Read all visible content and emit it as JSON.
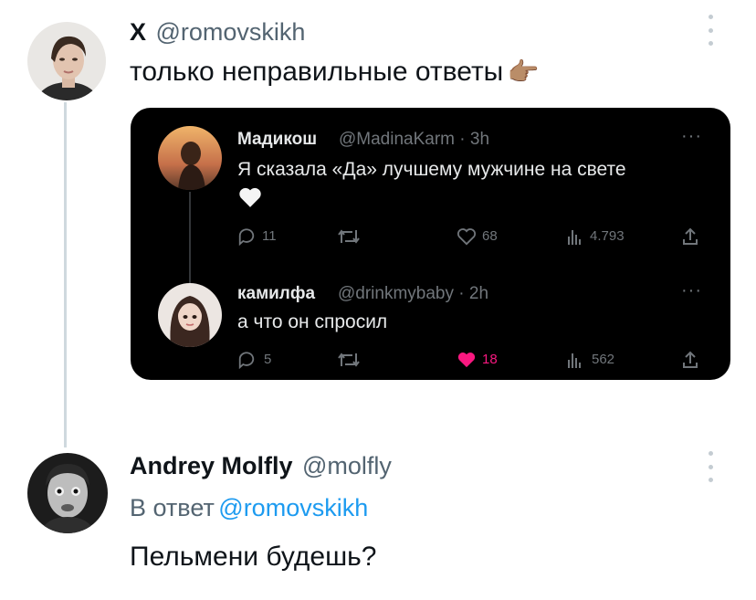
{
  "main_tweet": {
    "author_name": "X",
    "author_handle": "@romovskikh",
    "text": "только неправильные ответы",
    "emoji": "👉🏽"
  },
  "quoted_card": {
    "tweet1": {
      "name": "Мадикош",
      "handle_time": "@MadinaKarm · 3h",
      "text": "Я сказала «Да» лучшему мужчине на свете",
      "emoji": "🤍",
      "replies": "11",
      "likes": "68",
      "views": "4.793"
    },
    "tweet2": {
      "name": "камилфа",
      "handle_time": "@drinkmybaby · 2h",
      "text": "а что он спросил",
      "replies": "5",
      "likes": "18",
      "views": "562"
    }
  },
  "reply_tweet": {
    "author_name": "Andrey Molfly",
    "author_handle": "@molfly",
    "reply_prefix": "В ответ",
    "reply_to": "@romovskikh",
    "text": "Пельмени будешь?"
  },
  "colors": {
    "text": "#0f1419",
    "secondary": "#536471",
    "link": "#1d9bf0",
    "card_bg": "#000000",
    "like_active": "#f91880"
  }
}
